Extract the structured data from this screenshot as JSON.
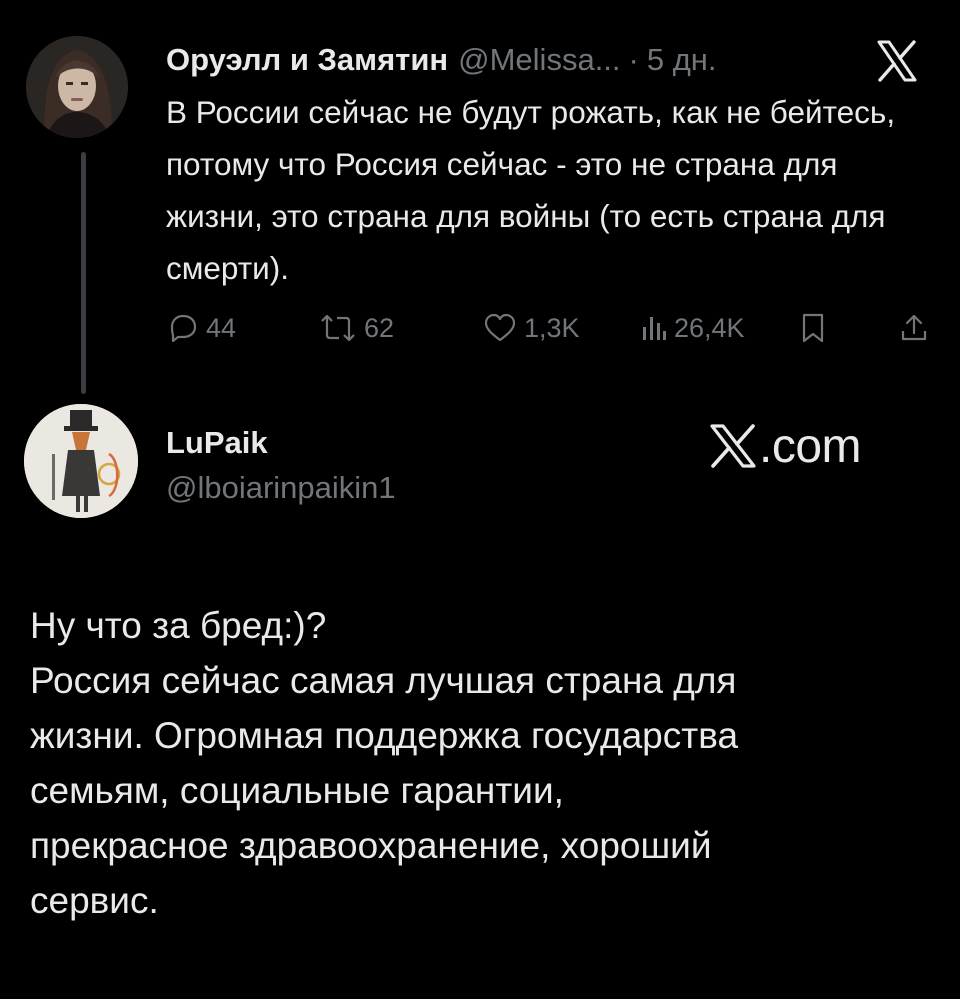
{
  "parent_tweet": {
    "author_name": "Оруэлл и Замятин",
    "handle": "@Melissa...",
    "separator": "·",
    "time": "5 дн.",
    "text": "В России сейчас не будут рожать, как не бейтесь, потому что Россия сейчас - это не страна для жизни, это страна для войны (то есть страна для смерти).",
    "actions": {
      "replies": "44",
      "reposts": "62",
      "likes": "1,3K",
      "views": "26,4K"
    },
    "icons": [
      "x-logo-icon",
      "reply-icon",
      "repost-icon",
      "like-icon",
      "views-icon",
      "bookmark-icon",
      "share-icon"
    ]
  },
  "reply": {
    "author_name": "LuPaik",
    "handle": "@lboiarinpaikin1",
    "brand": "com",
    "lines": [
      "Ну что за бред:)?",
      "Россия сейчас самая лучшая страна для",
      "жизни. Огромная поддержка государства",
      "семьям, социальные гарантии,",
      "прекрасное здравоохранение, хороший",
      "сервис."
    ]
  },
  "colors": {
    "background": "#000000",
    "text": "#e7e9ea",
    "secondary": "#71767b",
    "thread_line": "#3a3d41"
  }
}
